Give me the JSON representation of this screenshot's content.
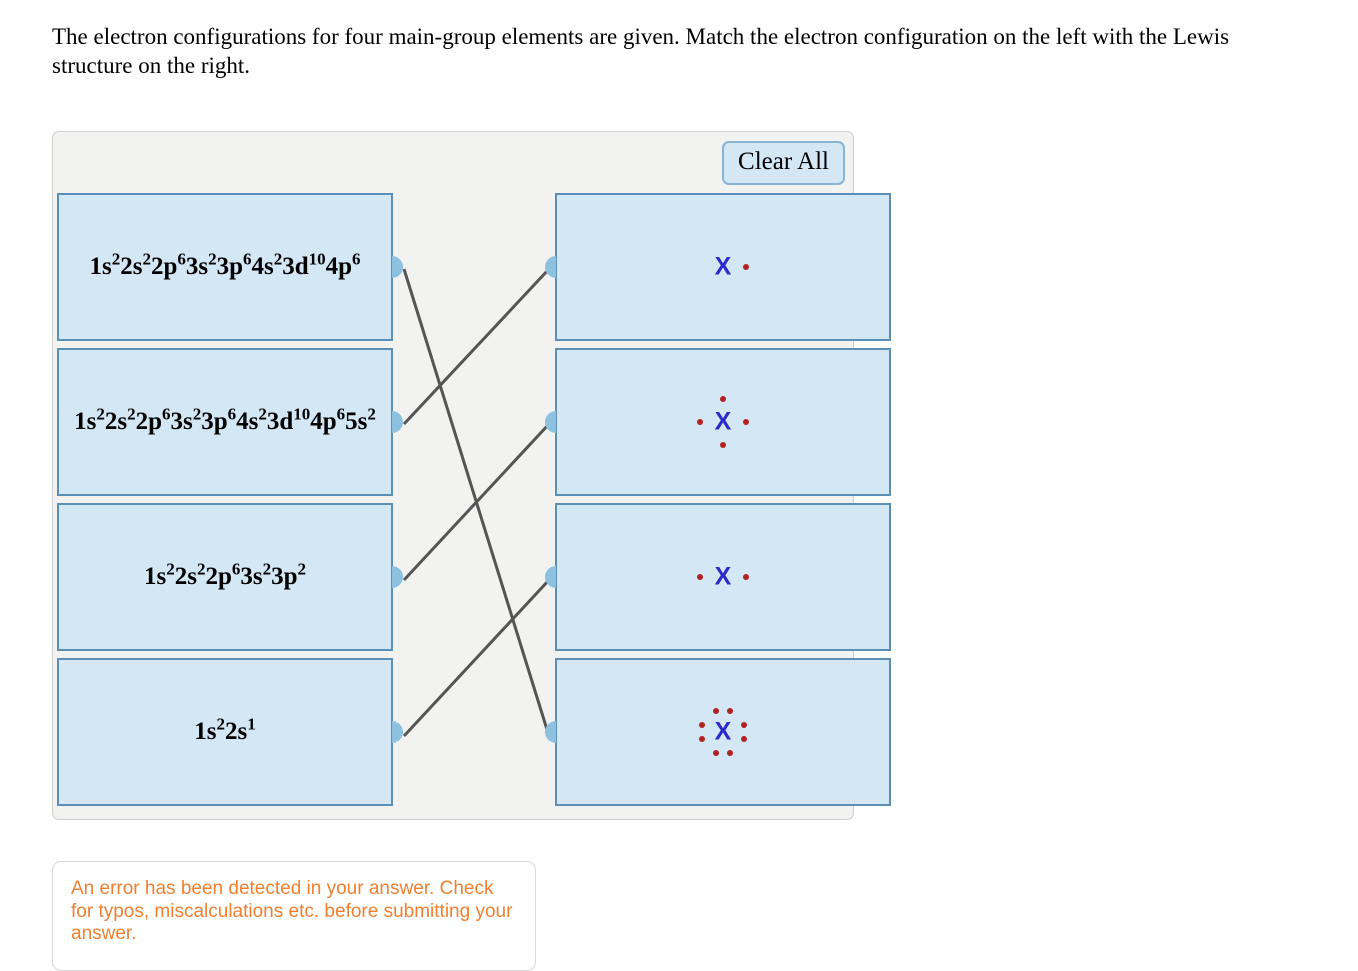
{
  "prompt": {
    "text": "The electron configurations for four main-group elements are given. Match the electron configuration on the left with the Lewis structure on the right."
  },
  "widget": {
    "clear_all_label": "Clear All",
    "left_items": [
      {
        "id": "left-1",
        "config_html": "1s<sup>2</sup>2s<sup>2</sup>2p<sup>6</sup>3s<sup>2</sup>3p<sup>6</sup>4s<sup>2</sup>3d<sup>10</sup>4p<sup>6</sup>",
        "config_plain": "1s22s22p63s23p64s23d104p6"
      },
      {
        "id": "left-2",
        "config_html": "1s<sup>2</sup>2s<sup>2</sup>2p<sup>6</sup>3s<sup>2</sup>3p<sup>6</sup>4s<sup>2</sup>3d<sup>10</sup>4p<sup>6</sup>5s<sup>2</sup>",
        "config_plain": "1s22s22p63s23p64s23d104p65s2"
      },
      {
        "id": "left-3",
        "config_html": "1s<sup>2</sup>2s<sup>2</sup>2p<sup>6</sup>3s<sup>2</sup>3p<sup>2</sup>",
        "config_plain": "1s22s22p63s23p2"
      },
      {
        "id": "left-4",
        "config_html": "1s<sup>2</sup>2s<sup>1</sup>",
        "config_plain": "1s22s1"
      }
    ],
    "right_items": [
      {
        "id": "right-1",
        "atom_label": "X",
        "dot_count": 1,
        "dots": [
          "right"
        ]
      },
      {
        "id": "right-2",
        "atom_label": "X",
        "dot_count": 4,
        "dots": [
          "top",
          "right",
          "bottom",
          "left"
        ]
      },
      {
        "id": "right-3",
        "atom_label": "X",
        "dot_count": 2,
        "dots": [
          "left",
          "right"
        ]
      },
      {
        "id": "right-4",
        "atom_label": "X",
        "dot_count": 8,
        "dots": [
          "top-left",
          "top-right",
          "right-upper",
          "right-lower",
          "bottom-right",
          "bottom-left",
          "left-lower",
          "left-upper"
        ]
      }
    ],
    "connections": [
      {
        "from": "left-1",
        "to": "right-4"
      },
      {
        "from": "left-2",
        "to": "right-1"
      },
      {
        "from": "left-3",
        "to": "right-2"
      },
      {
        "from": "left-4",
        "to": "right-3"
      }
    ],
    "colors": {
      "box_fill": "#d3e7f4",
      "box_border": "#5b8fb5",
      "panel_fill": "#f2f2f1",
      "nub": "#8cc2e0",
      "atom": "#2b2bcc",
      "dot": "#b4231f",
      "line": "#555555"
    }
  },
  "error": {
    "message": "An error has been detected in your answer. Check for typos, miscalculations etc. before submitting your answer.",
    "color": "#f08030"
  }
}
